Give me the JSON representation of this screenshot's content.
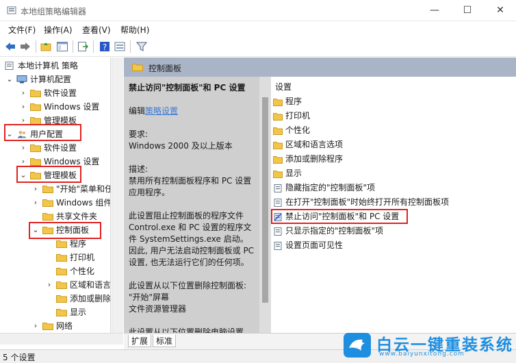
{
  "window": {
    "title": "本地组策略编辑器",
    "minimize_glyph": "—",
    "maximize_glyph": "☐",
    "close_glyph": "✕"
  },
  "menu": {
    "items": [
      "文件(F)",
      "操作(A)",
      "查看(V)",
      "帮助(H)"
    ]
  },
  "tree": {
    "root": "本地计算机 策略",
    "computer_config": "计算机配置",
    "cc_software": "软件设置",
    "cc_windows": "Windows 设置",
    "cc_admin": "管理模板",
    "user_config": "用户配置",
    "uc_software": "软件设置",
    "uc_windows": "Windows 设置",
    "uc_admin": "管理模板",
    "start_menu": "\"开始\"菜单和任",
    "windows_components": "Windows 组件",
    "shared_folders": "共享文件夹",
    "control_panel": "控制面板",
    "cp_programs": "程序",
    "cp_printers": "打印机",
    "cp_personalization": "个性化",
    "cp_region": "区域和语言",
    "cp_addremove": "添加或删除",
    "cp_display": "显示",
    "network": "网络"
  },
  "middle": {
    "header": "控制面板",
    "policy_title": "禁止访问\"控制面板\"和 PC 设置",
    "edit_prefix": "编辑",
    "edit_link": "策略设置",
    "requirements_label": "要求:",
    "requirements_value": "Windows 2000 及以上版本",
    "description_label": "描述:",
    "description_value": "禁用所有控制面板程序和 PC 设置应用程序。",
    "detail": "此设置阻止控制面板的程序文件 Control.exe 和 PC 设置的程序文件 SystemSettings.exe 启动。因此, 用户无法启动控制面板或 PC 设置, 也无法运行它们的任何项。",
    "removal_label": "此设置从以下位置删除控制面板:",
    "removal_1": "\"开始\"屏幕",
    "removal_2": "文件资源管理器",
    "removal_3": "此设置从以下位置删除电脑设置"
  },
  "right": {
    "column_header": "设置",
    "rows": [
      {
        "label": "程序",
        "kind": "folder"
      },
      {
        "label": "打印机",
        "kind": "folder"
      },
      {
        "label": "个性化",
        "kind": "folder"
      },
      {
        "label": "区域和语言选项",
        "kind": "folder"
      },
      {
        "label": "添加或删除程序",
        "kind": "folder"
      },
      {
        "label": "显示",
        "kind": "folder"
      },
      {
        "label": "隐藏指定的\"控制面板\"项",
        "kind": "setting"
      },
      {
        "label": "在打开\"控制面板\"时始终打开所有控制面板项",
        "kind": "setting"
      },
      {
        "label": "禁止访问\"控制面板\"和 PC 设置",
        "kind": "setting"
      },
      {
        "label": "只显示指定的\"控制面板\"项",
        "kind": "setting"
      },
      {
        "label": "设置页面可见性",
        "kind": "setting"
      }
    ]
  },
  "tabs": [
    "扩展",
    "标准"
  ],
  "status": "5 个设置",
  "watermark": {
    "text": "白云一键重装系统",
    "url": "www.baiyunxitong.com"
  },
  "colors": {
    "accent_blue": "#1e8ee0",
    "highlight_red": "#e02020",
    "header_gray_blue": "#a9b5c7",
    "folder_yellow": "#f3c64a"
  }
}
